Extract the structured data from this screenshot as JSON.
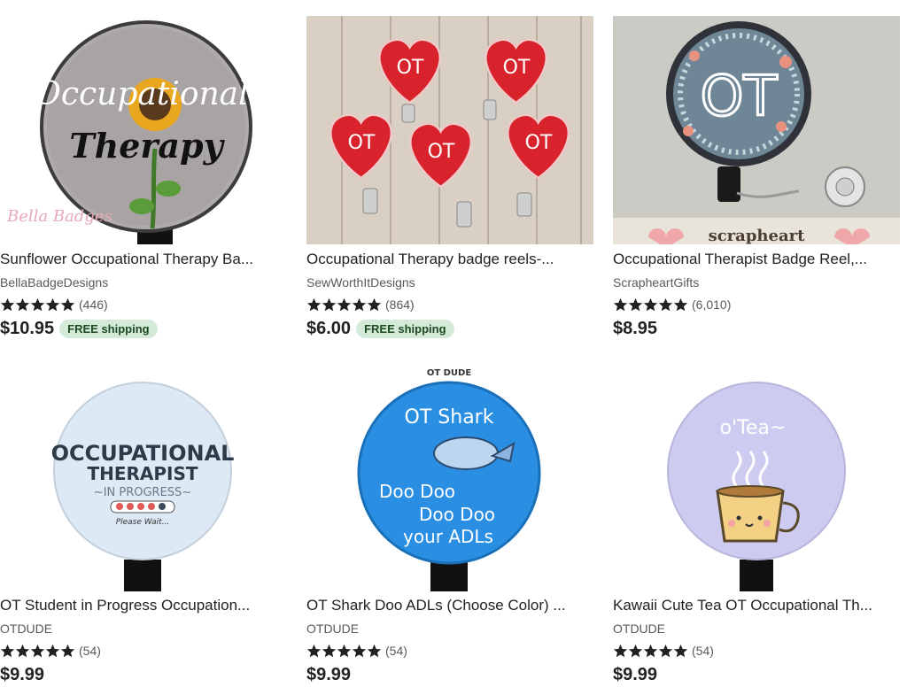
{
  "listings": [
    {
      "title": "Sunflower Occupational Therapy Ba...",
      "shop": "BellaBadgeDesigns",
      "reviews": "(446)",
      "price": "$10.95",
      "shipping": "FREE shipping",
      "image": {
        "bg": "#a8a3a3",
        "text_lines": [
          "Occupational",
          "Therapy"
        ],
        "watermark": "Bella Badges"
      }
    },
    {
      "title": "Occupational Therapy badge reels-...",
      "shop": "SewWorthItDesigns",
      "reviews": "(864)",
      "price": "$6.00",
      "shipping": "FREE shipping",
      "image": {
        "bg": "#d9cfc3",
        "heart_text": "OT"
      }
    },
    {
      "title": "Occupational Therapist Badge Reel,...",
      "shop": "ScrapheartGifts",
      "reviews": "(6,010)",
      "price": "$8.95",
      "shipping": "",
      "image": {
        "bg": "#c9c8c3",
        "badge_text": "OT",
        "banner": "scrapheart"
      }
    },
    {
      "title": "OT Student in Progress Occupation...",
      "shop": "OTDUDE",
      "reviews": "(54)",
      "price": "$9.99",
      "shipping": "",
      "image": {
        "bg": "#dfe9f4",
        "text_lines": [
          "OCCUPATIONAL",
          "THERAPIST",
          "~IN PROGRESS~",
          "Please Wait..."
        ]
      }
    },
    {
      "title": "OT Shark Doo ADLs (Choose Color) ...",
      "shop": "OTDUDE",
      "reviews": "(54)",
      "price": "$9.99",
      "shipping": "",
      "image": {
        "bg": "#2b8fe0",
        "text_lines": [
          "OT Shark",
          "Doo Doo",
          "Doo Doo",
          "your ADLs"
        ],
        "logo": "OT DUDE"
      }
    },
    {
      "title": "Kawaii Cute Tea OT Occupational Th...",
      "shop": "OTDUDE",
      "reviews": "(54)",
      "price": "$9.99",
      "shipping": "",
      "image": {
        "bg": "#cfcdf0",
        "text_lines": [
          "o'Tea~"
        ]
      }
    }
  ]
}
